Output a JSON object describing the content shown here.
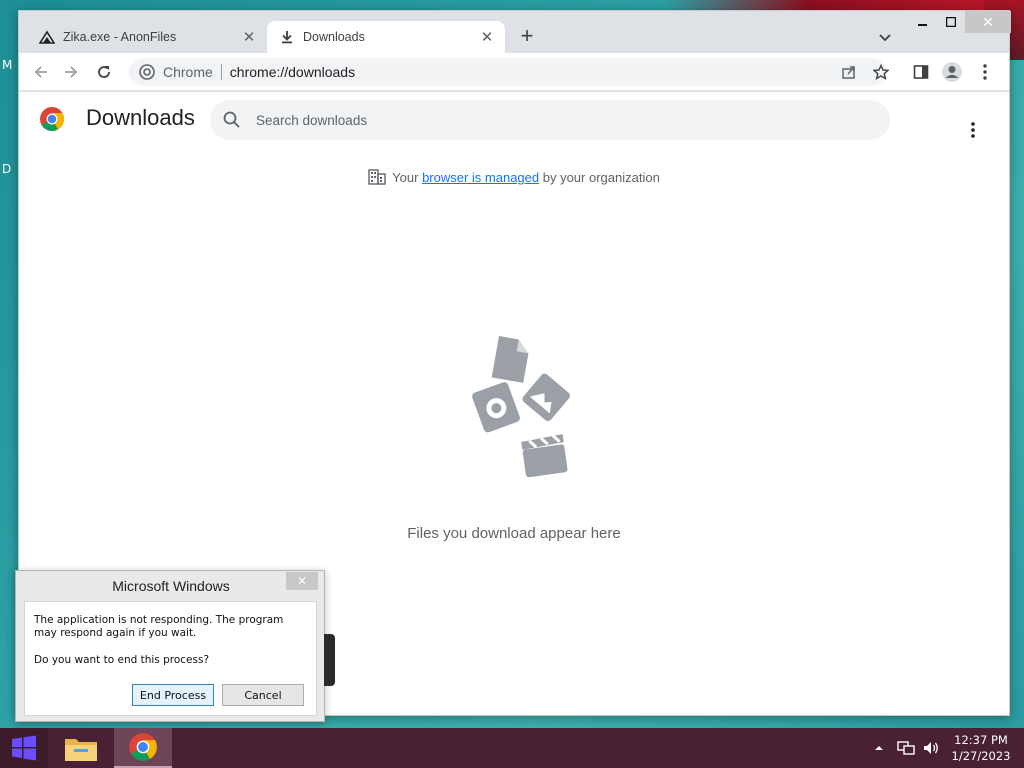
{
  "desktop": {
    "icon_letters": [
      "M",
      "D"
    ]
  },
  "browser": {
    "tabs": [
      {
        "title": "Zika.exe - AnonFiles",
        "active": false
      },
      {
        "title": "Downloads",
        "active": true
      }
    ],
    "omnibox": {
      "chip_label": "Chrome",
      "url": "chrome://downloads"
    }
  },
  "downloads_page": {
    "title": "Downloads",
    "search_placeholder": "Search downloads",
    "managed_notice": {
      "prefix": "Your ",
      "link": "browser is managed",
      "suffix": " by your organization"
    },
    "empty_message": "Files you download appear here"
  },
  "dialog": {
    "title": "Microsoft Windows",
    "close_label": "✕",
    "message": "The application is not responding. The program may respond again if you wait.",
    "question": "Do you want to end this process?",
    "primary_button": "End Process",
    "cancel_button": "Cancel"
  },
  "taskbar": {
    "time": "12:37 PM",
    "date": "1/27/2023"
  },
  "colors": {
    "accent_link": "#1a73e8",
    "taskbar": "#4a2134",
    "desktop": "#2fa4a8"
  }
}
